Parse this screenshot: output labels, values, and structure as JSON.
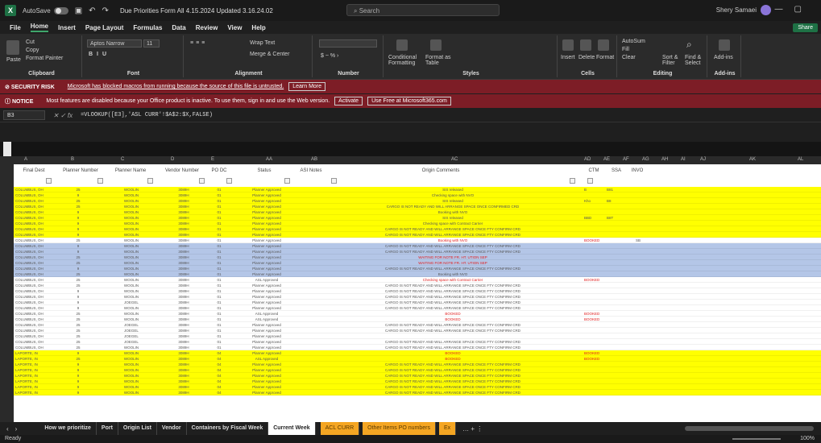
{
  "titlebar": {
    "autosave": "AutoSave",
    "file_name": "Due Priorities Form All 4.15.2024 Updated 3.16.24.02",
    "search_placeholder": "Search",
    "user": "Shery Samaei"
  },
  "menu": [
    "File",
    "Home",
    "Insert",
    "Page Layout",
    "Formulas",
    "Data",
    "Review",
    "View",
    "Help"
  ],
  "share": "Share",
  "ribbon": {
    "groups": [
      "Clipboard",
      "Font",
      "Alignment",
      "Number",
      "Styles",
      "Cells",
      "Editing",
      "Add-ins"
    ],
    "paste": "Paste",
    "cut": "Cut",
    "copy": "Copy",
    "format_painter": "Format Painter",
    "font_name": "Aptos Narrow",
    "font_size": "11",
    "wrap_text": "Wrap Text",
    "merge_center": "Merge & Center",
    "conditional_formatting": "Conditional Formatting",
    "format_as_table": "Format as Table",
    "insert": "Insert",
    "delete": "Delete",
    "format": "Format",
    "autosum": "AutoSum",
    "fill": "Fill",
    "clear": "Clear",
    "sort_filter": "Sort & Filter",
    "find_select": "Find & Select",
    "add_ins": "Add-ins"
  },
  "notices": {
    "security_tag": "SECURITY RISK",
    "security_msg": "Microsoft has blocked macros from running because the source of this file is untrusted.",
    "security_btn": "Learn More",
    "notice_tag": "NOTICE",
    "notice_msg": "Most features are disabled because your Office product is inactive. To use them, sign in and use the Web version.",
    "activate_btn": "Activate",
    "use_web_btn": "Use Free at Microsoft365.com"
  },
  "formula_bar": {
    "name_box": "B3",
    "formula": "=VLOOKUP([E3],'ASL CURR'!$A$2:$X,FALSE)"
  },
  "grid": {
    "column_letters": [
      "A",
      "B",
      "C",
      "D",
      "E",
      "AA",
      "AB",
      "AC",
      "AD",
      "AE",
      "AF",
      "AG",
      "AH",
      "AI",
      "AJ",
      "AK",
      "AL"
    ],
    "headers": [
      "Final Dest",
      "Planner Number",
      "Planner Name",
      "Vendor Number",
      "PO DC",
      "Status",
      "ASI Notes",
      "Origin Comments",
      "CTM",
      "SSA",
      "INVO"
    ],
    "rows": [
      {
        "bg": "yellow",
        "dest": "COLUMBUS, OH",
        "pn": "25",
        "name": "WOOLIN",
        "vn": "3089H",
        "dc": "01",
        "status": "Planner Approved",
        "comment": "SIS released",
        "c1": "B",
        "c2": "B81"
      },
      {
        "bg": "yellow",
        "dest": "COLUMBUS, OH",
        "pn": "9",
        "name": "WOOLIN",
        "vn": "3089H",
        "dc": "01",
        "status": "Planner Approved",
        "comment": "Checking space with NVO",
        "c1": "",
        "c2": ""
      },
      {
        "bg": "yellow",
        "dest": "COLUMBUS, OH",
        "pn": "25",
        "name": "WOOLIN",
        "vn": "3089H",
        "dc": "01",
        "status": "Planner Approved",
        "comment": "SIS released",
        "c1": "Kho",
        "c2": "B8"
      },
      {
        "bg": "yellow",
        "dest": "COLUMBUS, OH",
        "pn": "25",
        "name": "WOOLIN",
        "vn": "3089H",
        "dc": "01",
        "status": "Planner Approved",
        "comment": "CARGO IS NOT READY AND WILL ARRANGE SPACE ONCE CONFIRMED CRD",
        "c1": "",
        "c2": ""
      },
      {
        "bg": "yellow",
        "dest": "COLUMBUS, OH",
        "pn": "9",
        "name": "WOOLIN",
        "vn": "3089H",
        "dc": "01",
        "status": "Planner Approved",
        "comment": "Booking with NVO",
        "c1": "",
        "c2": ""
      },
      {
        "bg": "yellow",
        "dest": "COLUMBUS, OH",
        "pn": "9",
        "name": "WOOLIN",
        "vn": "3089H",
        "dc": "01",
        "status": "Planner Approved",
        "comment": "SIS released",
        "c1": "BBD",
        "c2": "B8T"
      },
      {
        "bg": "yellow",
        "dest": "COLUMBUS, OH",
        "pn": "9",
        "name": "WOOLIN",
        "vn": "3089H",
        "dc": "01",
        "status": "Planner Approved",
        "comment": "Checking space with Contract Carrier",
        "c1": "",
        "c2": ""
      },
      {
        "bg": "yellow",
        "dest": "COLUMBUS, OH",
        "pn": "9",
        "name": "WOOLIN",
        "vn": "3089H",
        "dc": "01",
        "status": "Planner Approved",
        "comment": "CARGO IS NOT READY AND WILL ARRANGE SPACE ONCE FTY CONFIRM CRD",
        "c1": "",
        "c2": ""
      },
      {
        "bg": "yellow",
        "dest": "COLUMBUS, OH",
        "pn": "9",
        "name": "WOOLIN",
        "vn": "3089H",
        "dc": "01",
        "status": "Planner Approved",
        "comment": "CARGO IS NOT READY AND WILL ARRANGE SPACE ONCE FTY CONFIRM CRD",
        "c1": "",
        "c2": ""
      },
      {
        "bg": "white",
        "dest": "COLUMBUS, OH",
        "pn": "25",
        "name": "WOOLIN",
        "vn": "3089H",
        "dc": "01",
        "status": "Planner Approved",
        "comment": "Booking with NVO",
        "red": true,
        "c1": "BOOKED",
        "c2": "",
        "c3": "SB"
      },
      {
        "bg": "blue",
        "dest": "COLUMBUS, OH",
        "pn": "9",
        "name": "WOOLIN",
        "vn": "3089H",
        "dc": "01",
        "status": "Planner Approved",
        "comment": "CARGO IS NOT READY AND WILL ARRANGE SPACE ONCE FTY CONFIRM CRD",
        "c1": "",
        "c2": ""
      },
      {
        "bg": "blue",
        "dest": "COLUMBUS, OH",
        "pn": "9",
        "name": "WOOLIN",
        "vn": "3089H",
        "dc": "01",
        "status": "Planner Approved",
        "comment": "CARGO IS NOT READY AND WILL ARRANGE SPACE ONCE FTY CONFIRM CRD",
        "c1": "",
        "c2": ""
      },
      {
        "bg": "blue",
        "dest": "COLUMBUS, OH",
        "pn": "25",
        "name": "WOOLIN",
        "vn": "3089H",
        "dc": "01",
        "status": "Planner Approved",
        "comment": "WAITING FOR NOTE FR. HT. UTION SEP",
        "red": true,
        "c1": "",
        "c2": ""
      },
      {
        "bg": "blue",
        "dest": "COLUMBUS, OH",
        "pn": "25",
        "name": "WOOLIN",
        "vn": "3089H",
        "dc": "01",
        "status": "Planner Approved",
        "comment": "WAITING FOR NOTE FR. HT. UTION SEP",
        "red": true,
        "c1": "",
        "c2": ""
      },
      {
        "bg": "blue",
        "dest": "COLUMBUS, OH",
        "pn": "9",
        "name": "WOOLIN",
        "vn": "3089H",
        "dc": "01",
        "status": "Planner Approved",
        "comment": "CARGO IS NOT READY AND WILL ARRANGE SPACE ONCE FTY CONFIRM CRD",
        "c1": "",
        "c2": ""
      },
      {
        "bg": "blue",
        "dest": "COLUMBUS, OH",
        "pn": "25",
        "name": "WOOLIN",
        "vn": "3089H",
        "dc": "01",
        "status": "Planner Approved",
        "comment": "Booking with NVO",
        "c1": "",
        "c2": ""
      },
      {
        "bg": "white",
        "dest": "COLUMBUS, OH",
        "pn": "25",
        "name": "WOOLIN",
        "vn": "3089H",
        "dc": "01",
        "status": "ASL Approved",
        "comment": "Checking space with Contract Carrier",
        "red": true,
        "c1": "BOOKED",
        "c2": ""
      },
      {
        "bg": "white",
        "dest": "COLUMBUS, OH",
        "pn": "25",
        "name": "WOOLIN",
        "vn": "3089H",
        "dc": "01",
        "status": "Planner Approved",
        "comment": "CARGO IS NOT READY AND WILL ARRANGE SPACE ONCE FTY CONFIRM CRD",
        "c1": "",
        "c2": ""
      },
      {
        "bg": "white",
        "dest": "COLUMBUS, OH",
        "pn": "9",
        "name": "WOOLIN",
        "vn": "3089H",
        "dc": "01",
        "status": "Planner Approved",
        "comment": "CARGO IS NOT READY AND WILL ARRANGE SPACE ONCE FTY CONFIRM CRD",
        "c1": "",
        "c2": ""
      },
      {
        "bg": "white",
        "dest": "COLUMBUS, OH",
        "pn": "9",
        "name": "WOOLIN",
        "vn": "3089H",
        "dc": "01",
        "status": "Planner Approved",
        "comment": "CARGO IS NOT READY AND WILL ARRANGE SPACE ONCE FTY CONFIRM CRD",
        "c1": "",
        "c2": ""
      },
      {
        "bg": "white",
        "dest": "COLUMBUS, OH",
        "pn": "9",
        "name": "JOEGEL",
        "vn": "3089H",
        "dc": "01",
        "status": "Planner Approved",
        "comment": "CARGO IS NOT READY AND WILL ARRANGE SPACE ONCE FTY CONFIRM CRD",
        "c1": "",
        "c2": ""
      },
      {
        "bg": "white",
        "dest": "COLUMBUS, OH",
        "pn": "9",
        "name": "WOOLIN",
        "vn": "3089H",
        "dc": "01",
        "status": "Planner Approved",
        "comment": "CARGO IS NOT READY AND WILL ARRANGE SPACE ONCE FTY CONFIRM CRD",
        "c1": "",
        "c2": ""
      },
      {
        "bg": "white",
        "dest": "COLUMBUS, OH",
        "pn": "25",
        "name": "WOOLIN",
        "vn": "3089H",
        "dc": "01",
        "status": "ASL Approved",
        "comment": "BOOKED",
        "red": true,
        "c1": "BOOKED",
        "c2": ""
      },
      {
        "bg": "white",
        "dest": "COLUMBUS, OH",
        "pn": "25",
        "name": "WOOLIN",
        "vn": "3089H",
        "dc": "01",
        "status": "ASL Approved",
        "comment": "BOOKED",
        "red": true,
        "c1": "BOOKED",
        "c2": ""
      },
      {
        "bg": "white",
        "dest": "COLUMBUS, OH",
        "pn": "25",
        "name": "JOEGEL",
        "vn": "3089H",
        "dc": "01",
        "status": "Planner Approved",
        "comment": "CARGO IS NOT READY AND WILL ARRANGE SPACE ONCE FTY CONFIRM CRD",
        "c1": "",
        "c2": ""
      },
      {
        "bg": "white",
        "dest": "COLUMBUS, OH",
        "pn": "25",
        "name": "JOEGEL",
        "vn": "3089H",
        "dc": "01",
        "status": "Planner Approved",
        "comment": "CARGO IS NOT READY AND WILL ARRANGE SPACE ONCE FTY CONFIRM CRD",
        "c1": "",
        "c2": ""
      },
      {
        "bg": "white",
        "dest": "COLUMBUS, OH",
        "pn": "25",
        "name": "JOEGEL",
        "vn": "3089H",
        "dc": "01",
        "status": "Planner Approved",
        "comment": "",
        "c1": "",
        "c2": ""
      },
      {
        "bg": "white",
        "dest": "COLUMBUS, OH",
        "pn": "25",
        "name": "JOEGEL",
        "vn": "3089H",
        "dc": "01",
        "status": "Planner Approved",
        "comment": "CARGO IS NOT READY AND WILL ARRANGE SPACE ONCE FTY CONFIRM CRD",
        "c1": "",
        "c2": ""
      },
      {
        "bg": "white",
        "dest": "COLUMBUS, OH",
        "pn": "25",
        "name": "WOOLIN",
        "vn": "3089H",
        "dc": "01",
        "status": "Planner Approved",
        "comment": "CARGO IS NOT READY AND WILL ARRANGE SPACE ONCE FTY CONFIRM CRD",
        "c1": "",
        "c2": ""
      },
      {
        "bg": "yellow",
        "dest": "LAPORTE, IN",
        "pn": "9",
        "name": "WOOLIN",
        "vn": "3089H",
        "dc": "04",
        "status": "Planner Approved",
        "comment": "BOOKED",
        "red": true,
        "c1": "BOOKED",
        "c2": ""
      },
      {
        "bg": "yellow",
        "dest": "LAPORTE, IN",
        "pn": "25",
        "name": "WOOLIN",
        "vn": "3089H",
        "dc": "04",
        "status": "ASL Approved",
        "comment": "BOOKED",
        "red": true,
        "c1": "BOOKED",
        "c2": ""
      },
      {
        "bg": "yellow",
        "dest": "LAPORTE, IN",
        "pn": "9",
        "name": "WOOLIN",
        "vn": "3089H",
        "dc": "04",
        "status": "Planner Approved",
        "comment": "CARGO IS NOT READY AND WILL ARRANGE SPACE ONCE FTY CONFIRM CRD",
        "c1": "",
        "c2": ""
      },
      {
        "bg": "yellow",
        "dest": "LAPORTE, IN",
        "pn": "9",
        "name": "WOOLIN",
        "vn": "3089H",
        "dc": "04",
        "status": "Planner Approved",
        "comment": "CARGO IS NOT READY AND WILL ARRANGE SPACE ONCE FTY CONFIRM CRD",
        "c1": "",
        "c2": ""
      },
      {
        "bg": "yellow",
        "dest": "LAPORTE, IN",
        "pn": "9",
        "name": "WOOLIN",
        "vn": "3089H",
        "dc": "04",
        "status": "Planner Approved",
        "comment": "CARGO IS NOT READY AND WILL ARRANGE SPACE ONCE FTY CONFIRM CRD",
        "c1": "",
        "c2": ""
      },
      {
        "bg": "yellow",
        "dest": "LAPORTE, IN",
        "pn": "9",
        "name": "WOOLIN",
        "vn": "3089H",
        "dc": "04",
        "status": "Planner Approved",
        "comment": "CARGO IS NOT READY AND WILL ARRANGE SPACE ONCE FTY CONFIRM CRD",
        "c1": "",
        "c2": ""
      },
      {
        "bg": "yellow",
        "dest": "LAPORTE, IN",
        "pn": "9",
        "name": "WOOLIN",
        "vn": "3089H",
        "dc": "04",
        "status": "Planner Approved",
        "comment": "CARGO IS NOT READY AND WILL ARRANGE SPACE ONCE FTY CONFIRM CRD",
        "c1": "",
        "c2": ""
      },
      {
        "bg": "yellow",
        "dest": "LAPORTE, IN",
        "pn": "9",
        "name": "WOOLIN",
        "vn": "3089H",
        "dc": "04",
        "status": "Planner Approved",
        "comment": "CARGO IS NOT READY AND WILL ARRANGE SPACE ONCE FTY CONFIRM CRD",
        "c1": "",
        "c2": ""
      }
    ]
  },
  "sheets": {
    "tabs": [
      "How we prioritize",
      "Port",
      "Origin List",
      "Vendor",
      "Containers by Fiscal Week",
      "Current Week"
    ],
    "orange_tabs": [
      "ACL CURR",
      "Other Items PO numbers",
      "Ex"
    ],
    "active": "Current Week"
  },
  "status": {
    "ready": "Ready",
    "zoom": "100%"
  }
}
